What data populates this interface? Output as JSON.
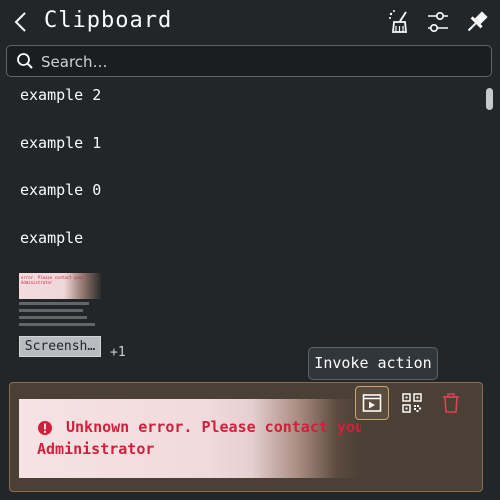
{
  "header": {
    "title": "Clipboard",
    "icons": [
      "back-arrow-icon",
      "clear-history-broom-icon",
      "configure-sliders-icon",
      "pin-icon"
    ]
  },
  "search": {
    "placeholder": "Search…",
    "value": ""
  },
  "history": {
    "items": [
      {
        "text": "example 2"
      },
      {
        "text": "example 1"
      },
      {
        "text": "example 0"
      },
      {
        "text": "example"
      }
    ],
    "image_item": {
      "thumbnail_text": "error. Please contact your Administrator",
      "chip_label": "Screensh…",
      "extra_count": "+1"
    }
  },
  "selected_item": {
    "line1": "Unknown error. Please contact your",
    "line2": "Administrator",
    "icon": "error-circle-icon",
    "actions": [
      {
        "icon": "invoke-action-icon"
      },
      {
        "icon": "qr-code-icon"
      },
      {
        "icon": "delete-trash-icon"
      }
    ]
  },
  "tooltip": {
    "text": "Invoke action"
  },
  "colors": {
    "background": "#232629",
    "text": "#fcfcfc",
    "error_red": "#d0203b",
    "selection_bg": "#4a4035",
    "selection_border": "#8a6e4a",
    "delete_red": "#da4453"
  }
}
